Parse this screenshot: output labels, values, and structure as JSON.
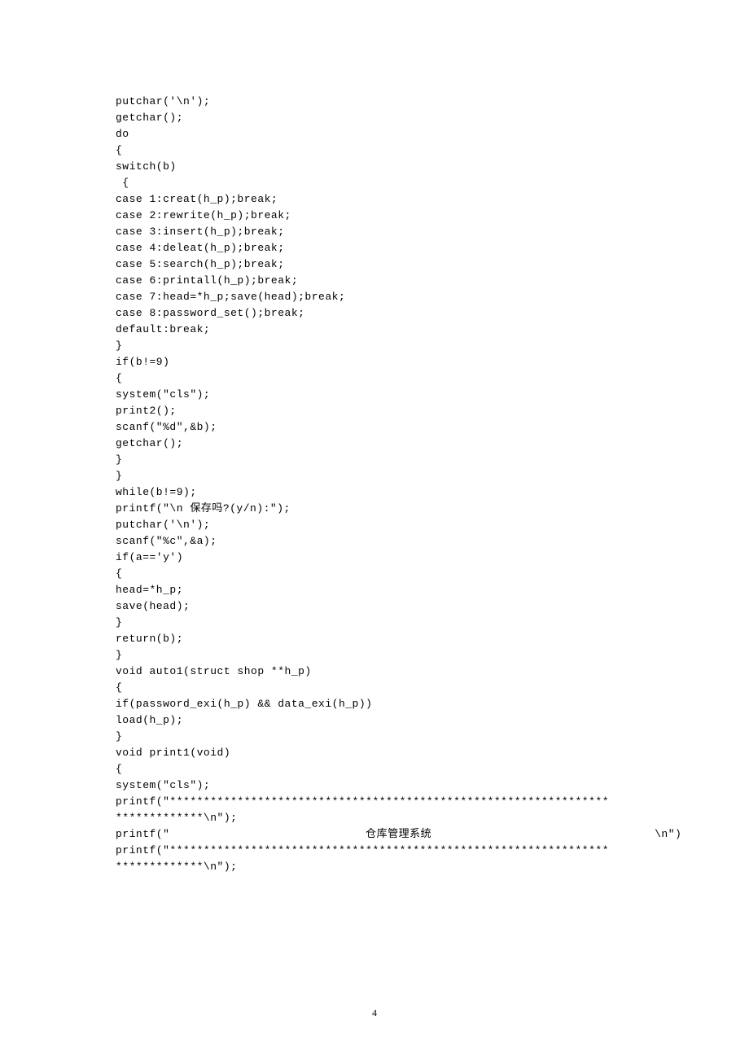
{
  "page_number": "4",
  "code": {
    "lines": [
      "putchar('\\n');",
      "getchar();",
      "do",
      "{",
      "switch(b)",
      " {",
      "case 1:creat(h_p);break;",
      "case 2:rewrite(h_p);break;",
      "case 3:insert(h_p);break;",
      "case 4:deleat(h_p);break;",
      "case 5:search(h_p);break;",
      "case 6:printall(h_p);break;",
      "case 7:head=*h_p;save(head);break;",
      "case 8:password_set();break;",
      "default:break;",
      "}",
      "if(b!=9)",
      "{",
      "system(\"cls\");",
      "print2();",
      "scanf(\"%d\",&b);",
      "getchar();",
      "}",
      "}",
      "while(b!=9);",
      "printf(\"\\n 保存吗?(y/n):\");",
      "putchar('\\n');",
      "scanf(\"%c\",&a);",
      "if(a=='y')",
      "{",
      "head=*h_p;",
      "save(head);",
      "}",
      "return(b);",
      "}",
      "",
      "",
      "void auto1(struct shop **h_p)",
      "{",
      "if(password_exi(h_p) && data_exi(h_p))",
      "load(h_p);",
      "}",
      "",
      "void print1(void)",
      "{",
      "system(\"cls\");",
      "printf(\"*****************************************************************",
      "*************\\n\");",
      "printf(\"                             仓库管理系统                                 \\n\")",
      "printf(\"*****************************************************************",
      "*************\\n\");"
    ]
  }
}
